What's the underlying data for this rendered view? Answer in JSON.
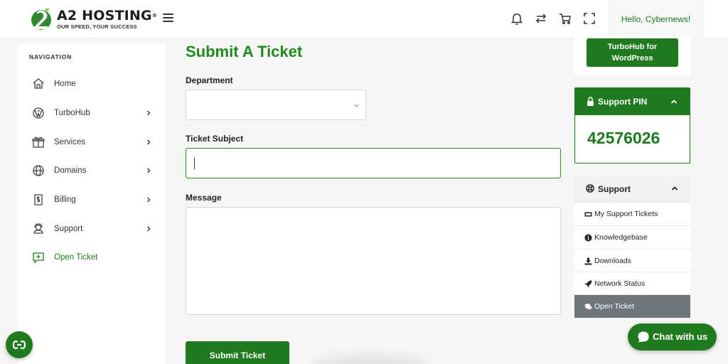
{
  "brand": {
    "name": "A2 HOSTING",
    "registered": "®",
    "tagline": "OUR SPEED, YOUR SUCCESS",
    "color": "#1f7a1f"
  },
  "header": {
    "greeting": "Hello, Cybernews!",
    "icons": [
      "menu-icon",
      "bell-icon",
      "swap-icon",
      "cart-icon",
      "fullscreen-icon"
    ]
  },
  "nav": {
    "title": "NAVIGATION",
    "items": [
      {
        "label": "Home",
        "icon": "home-icon",
        "chevron": false
      },
      {
        "label": "TurboHub",
        "icon": "wordpress-icon",
        "chevron": true
      },
      {
        "label": "Services",
        "icon": "box-icon",
        "chevron": true
      },
      {
        "label": "Domains",
        "icon": "globe-icon",
        "chevron": true
      },
      {
        "label": "Billing",
        "icon": "invoice-icon",
        "chevron": true
      },
      {
        "label": "Support",
        "icon": "headset-icon",
        "chevron": true
      },
      {
        "label": "Open Ticket",
        "icon": "ticket-add-icon",
        "chevron": false,
        "active": true
      }
    ]
  },
  "form": {
    "title": "Submit A Ticket",
    "department_label": "Department",
    "department_value": "",
    "subject_label": "Ticket Subject",
    "subject_value": "",
    "message_label": "Message",
    "message_value": "",
    "submit_label": "Submit Ticket"
  },
  "right": {
    "turbohub_button": "TurboHub for WordPress",
    "pin_title": "Support PIN",
    "pin_value": "42576026",
    "support_title": "Support",
    "support_items": [
      {
        "label": "My Support Tickets",
        "icon": "ticket-icon"
      },
      {
        "label": "Knowledgebase",
        "icon": "info-icon"
      },
      {
        "label": "Downloads",
        "icon": "download-icon"
      },
      {
        "label": "Network Status",
        "icon": "rocket-icon"
      },
      {
        "label": "Open Ticket",
        "icon": "comments-icon",
        "active": true
      }
    ]
  },
  "chat": {
    "label": "Chat with us"
  }
}
